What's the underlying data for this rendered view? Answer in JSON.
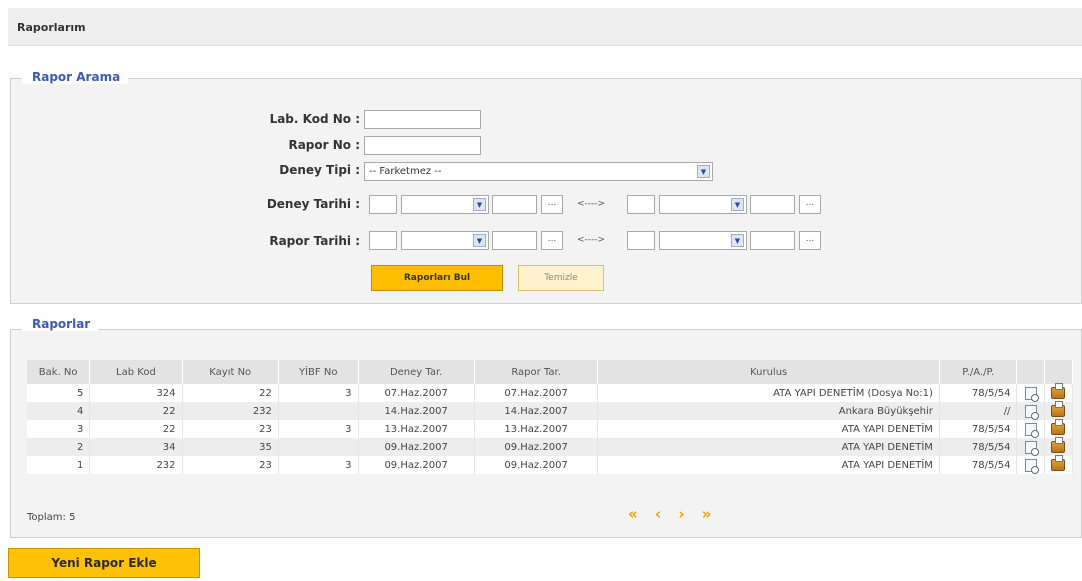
{
  "header": {
    "title": "Raporlarım"
  },
  "search": {
    "legend": "Rapor Arama",
    "lab_kod_label": "Lab. Kod No :",
    "rapor_no_label": "Rapor No :",
    "deney_tipi_label": "Deney Tipi :",
    "deney_tipi_value": "-- Farketmez --",
    "deney_tarihi_label": "Deney Tarihi :",
    "rapor_tarihi_label": "Rapor Tarihi :",
    "range_arrow": "<---->",
    "dots": "...",
    "find_button": "Raporları Bul",
    "clear_button": "Temizle"
  },
  "results": {
    "legend": "Raporlar",
    "columns": [
      "Bak. No",
      "Lab Kod",
      "Kayıt No",
      "YİBF No",
      "Deney Tar.",
      "Rapor Tar.",
      "Kurulus",
      "P./A./P."
    ],
    "rows": [
      {
        "bak": "5",
        "lab": "324",
        "kayit": "22",
        "yibf": "3",
        "deney": "07.Haz.2007",
        "rapor": "07.Haz.2007",
        "kurulus": "ATA YAPI DENETİM (Dosya No:1)",
        "pap": "78/5/54"
      },
      {
        "bak": "4",
        "lab": "22",
        "kayit": "232",
        "yibf": "",
        "deney": "14.Haz.2007",
        "rapor": "14.Haz.2007",
        "kurulus": "Ankara Büyükşehir",
        "pap": "//"
      },
      {
        "bak": "3",
        "lab": "22",
        "kayit": "23",
        "yibf": "3",
        "deney": "13.Haz.2007",
        "rapor": "13.Haz.2007",
        "kurulus": "ATA YAPI DENETİM",
        "pap": "78/5/54"
      },
      {
        "bak": "2",
        "lab": "34",
        "kayit": "35",
        "yibf": "",
        "deney": "09.Haz.2007",
        "rapor": "09.Haz.2007",
        "kurulus": "ATA YAPI DENETİM",
        "pap": "78/5/54"
      },
      {
        "bak": "1",
        "lab": "232",
        "kayit": "23",
        "yibf": "3",
        "deney": "09.Haz.2007",
        "rapor": "09.Haz.2007",
        "kurulus": "ATA YAPI DENETİM",
        "pap": "78/5/54"
      }
    ],
    "total": "Toplam: 5",
    "pager": {
      "first": "«",
      "prev": "‹",
      "next": "›",
      "last": "»"
    }
  },
  "actions": {
    "add_button": "Yeni Rapor Ekle"
  },
  "icons": {
    "view": "report-view-icon",
    "print": "print-icon"
  },
  "colors": {
    "accent": "#ffbf00",
    "legend": "#3b5ab8",
    "pager": "#f0a000"
  }
}
